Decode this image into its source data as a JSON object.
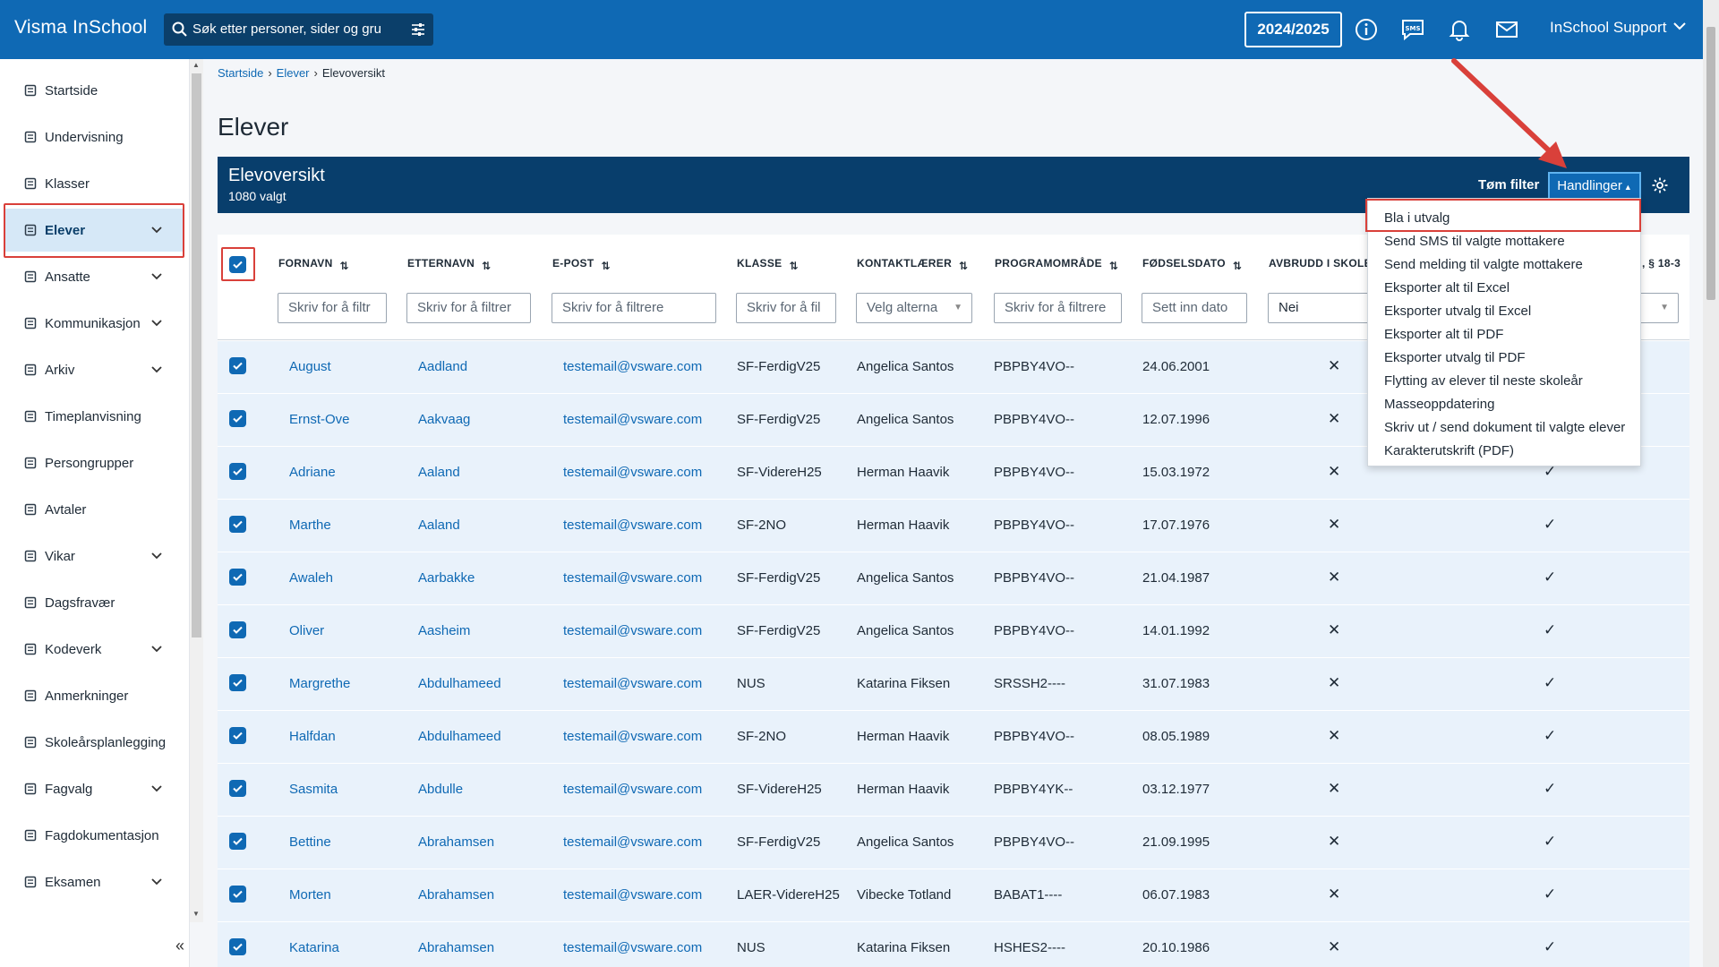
{
  "app": {
    "brand": "Visma InSchool",
    "search_placeholder": "Søk etter personer, sider og gru",
    "school_year": "2024/2025",
    "user": "InSchool Support"
  },
  "icons": {
    "search": "search-icon",
    "filter": "sliders-icon",
    "info": "info-icon",
    "sms": "sms-icon",
    "bell": "bell-icon",
    "mail": "mail-icon",
    "settings": "gear-icon"
  },
  "colors": {
    "topbar": "#0f69b4",
    "panel_header": "#083e6c",
    "row_bg": "#e9f2fb",
    "link": "#0f69b4",
    "highlight": "#d9403a"
  },
  "sidebar": {
    "items": [
      {
        "label": "Startside",
        "icon": "flag-icon",
        "expandable": false
      },
      {
        "label": "Undervisning",
        "icon": "book-icon",
        "expandable": false
      },
      {
        "label": "Klasser",
        "icon": "classroom-icon",
        "expandable": false
      },
      {
        "label": "Elever",
        "icon": "student-icon",
        "expandable": true,
        "active": true
      },
      {
        "label": "Ansatte",
        "icon": "briefcase-icon",
        "expandable": true
      },
      {
        "label": "Kommunikasjon",
        "icon": "chat-icon",
        "expandable": true
      },
      {
        "label": "Arkiv",
        "icon": "archive-icon",
        "expandable": true
      },
      {
        "label": "Timeplanvisning",
        "icon": "calendar-icon",
        "expandable": false
      },
      {
        "label": "Persongrupper",
        "icon": "group-icon",
        "expandable": false
      },
      {
        "label": "Avtaler",
        "icon": "calendar-check-icon",
        "expandable": false
      },
      {
        "label": "Vikar",
        "icon": "swap-icon",
        "expandable": true
      },
      {
        "label": "Dagsfravær",
        "icon": "person-clock-icon",
        "expandable": false
      },
      {
        "label": "Kodeverk",
        "icon": "database-icon",
        "expandable": true
      },
      {
        "label": "Anmerkninger",
        "icon": "hand-icon",
        "expandable": false
      },
      {
        "label": "Skoleårsplanlegging",
        "icon": "calendar-icon",
        "expandable": false
      },
      {
        "label": "Fagvalg",
        "icon": "list-icon",
        "expandable": true
      },
      {
        "label": "Fagdokumentasjon",
        "icon": "document-icon",
        "expandable": false
      },
      {
        "label": "Eksamen",
        "icon": "exam-icon",
        "expandable": true
      }
    ]
  },
  "breadcrumb": [
    "Startside",
    "Elever",
    "Elevoversikt"
  ],
  "page_title": "Elever",
  "panel": {
    "title": "Elevoversikt",
    "selected": "1080 valgt",
    "clear_filter": "Tøm filter",
    "actions": "Handlinger"
  },
  "columns": {
    "fornavn": "FORNAVN",
    "etternavn": "ETTERNAVN",
    "epost": "E-POST",
    "klasse": "KLASSE",
    "kontaktlaerer": "KONTAKTLÆRER",
    "programomrade": "PROGRAMOMRÅDE",
    "fodselsdato": "FØDSELSDATO",
    "avbrudd": "AVBRUDD I SKOLEÅ",
    "paragraf": ", § 18-3"
  },
  "filters": {
    "fornavn": "Skriv for å filtr",
    "etternavn": "Skriv for å filtrer",
    "epost": "Skriv for å filtrere",
    "klasse": "Skriv for å fil",
    "kontaktlaerer": "Velg alterna",
    "programomrade": "Skriv for å filtrere",
    "fodselsdato": "Sett inn dato",
    "avbrudd": "Nei"
  },
  "rows": [
    {
      "fornavn": "August",
      "etternavn": "Aadland",
      "epost": "testemail@vsware.com",
      "klasse": "SF-FerdigV25",
      "kontakt": "Angelica Santos",
      "program": "PBPBY4VO--",
      "dato": "24.06.2001",
      "avbrudd": "✕",
      "p": ""
    },
    {
      "fornavn": "Ernst-Ove",
      "etternavn": "Aakvaag",
      "epost": "testemail@vsware.com",
      "klasse": "SF-FerdigV25",
      "kontakt": "Angelica Santos",
      "program": "PBPBY4VO--",
      "dato": "12.07.1996",
      "avbrudd": "✕",
      "p": ""
    },
    {
      "fornavn": "Adriane",
      "etternavn": "Aaland",
      "epost": "testemail@vsware.com",
      "klasse": "SF-VidereH25",
      "kontakt": "Herman Haavik",
      "program": "PBPBY4VO--",
      "dato": "15.03.1972",
      "avbrudd": "✕",
      "p": "✓"
    },
    {
      "fornavn": "Marthe",
      "etternavn": "Aaland",
      "epost": "testemail@vsware.com",
      "klasse": "SF-2NO",
      "kontakt": "Herman Haavik",
      "program": "PBPBY4VO--",
      "dato": "17.07.1976",
      "avbrudd": "✕",
      "p": "✓"
    },
    {
      "fornavn": "Awaleh",
      "etternavn": "Aarbakke",
      "epost": "testemail@vsware.com",
      "klasse": "SF-FerdigV25",
      "kontakt": "Angelica Santos",
      "program": "PBPBY4VO--",
      "dato": "21.04.1987",
      "avbrudd": "✕",
      "p": "✓"
    },
    {
      "fornavn": "Oliver",
      "etternavn": "Aasheim",
      "epost": "testemail@vsware.com",
      "klasse": "SF-FerdigV25",
      "kontakt": "Angelica Santos",
      "program": "PBPBY4VO--",
      "dato": "14.01.1992",
      "avbrudd": "✕",
      "p": "✓"
    },
    {
      "fornavn": "Margrethe",
      "etternavn": "Abdulhameed",
      "epost": "testemail@vsware.com",
      "klasse": "NUS",
      "kontakt": "Katarina Fiksen",
      "program": "SRSSH2----",
      "dato": "31.07.1983",
      "avbrudd": "✕",
      "p": "✓"
    },
    {
      "fornavn": "Halfdan",
      "etternavn": "Abdulhameed",
      "epost": "testemail@vsware.com",
      "klasse": "SF-2NO",
      "kontakt": "Herman Haavik",
      "program": "PBPBY4VO--",
      "dato": "08.05.1989",
      "avbrudd": "✕",
      "p": "✓"
    },
    {
      "fornavn": "Sasmita",
      "etternavn": "Abdulle",
      "epost": "testemail@vsware.com",
      "klasse": "SF-VidereH25",
      "kontakt": "Herman Haavik",
      "program": "PBPBY4YK--",
      "dato": "03.12.1977",
      "avbrudd": "✕",
      "p": "✓"
    },
    {
      "fornavn": "Bettine",
      "etternavn": "Abrahamsen",
      "epost": "testemail@vsware.com",
      "klasse": "SF-FerdigV25",
      "kontakt": "Angelica Santos",
      "program": "PBPBY4VO--",
      "dato": "21.09.1995",
      "avbrudd": "✕",
      "p": "✓"
    },
    {
      "fornavn": "Morten",
      "etternavn": "Abrahamsen",
      "epost": "testemail@vsware.com",
      "klasse": "LAER-VidereH25",
      "kontakt": "Vibecke Totland",
      "program": "BABAT1----",
      "dato": "06.07.1983",
      "avbrudd": "✕",
      "p": "✓"
    },
    {
      "fornavn": "Katarina",
      "etternavn": "Abrahamsen",
      "epost": "testemail@vsware.com",
      "klasse": "NUS",
      "kontakt": "Katarina Fiksen",
      "program": "HSHES2----",
      "dato": "20.10.1986",
      "avbrudd": "✕",
      "p": "✓"
    }
  ],
  "menu": {
    "items": [
      "Bla i utvalg",
      "Send SMS til valgte mottakere",
      "Send melding til valgte mottakere",
      "Eksporter alt til Excel",
      "Eksporter utvalg til Excel",
      "Eksporter alt til PDF",
      "Eksporter utvalg til PDF",
      "Flytting av elever til neste skoleår",
      "Masseoppdatering",
      "Skriv ut / send dokument til valgte elever",
      "Karakterutskrift (PDF)"
    ]
  }
}
